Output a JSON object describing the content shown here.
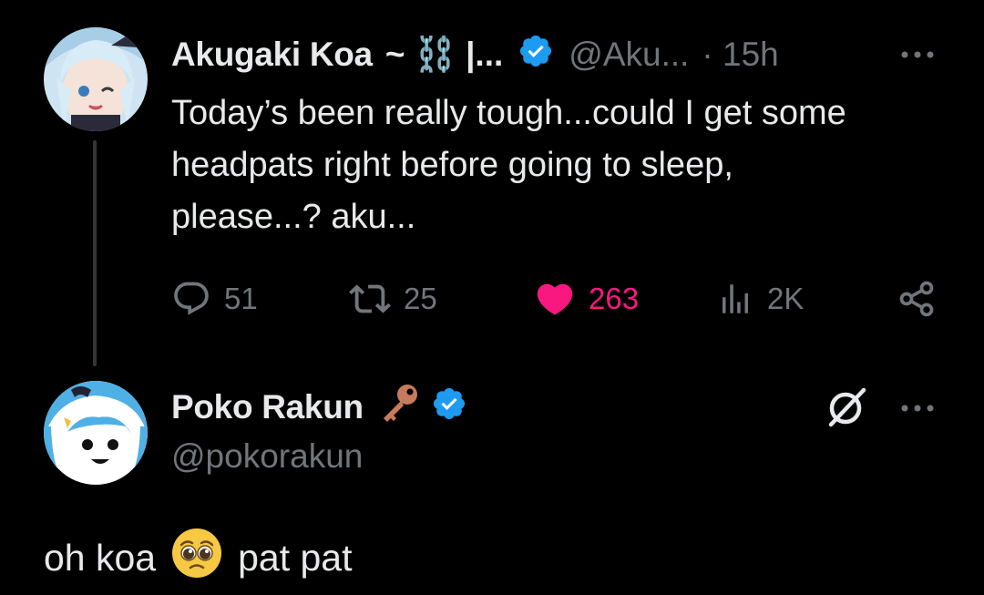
{
  "parent_tweet": {
    "display_name": "Akugaki Koa",
    "name_suffix": "~ ⛓️ |...",
    "handle": "@Aku...",
    "time": "· 15h",
    "text": "Today’s been really tough...could I get some\nheadpats right before going to sleep,\nplease...? aku...",
    "stats": {
      "replies": "51",
      "reposts": "25",
      "likes": "263",
      "views": "2K"
    }
  },
  "reply_tweet": {
    "display_name": "Poko Rakun",
    "handle": "@pokorakun",
    "text_before": "oh koa",
    "text_after": "pat pat"
  },
  "icons": {
    "verified": "verified-badge-icon",
    "more": "more-options-icon",
    "reply": "reply-icon",
    "repost": "repost-icon",
    "like": "heart-icon",
    "views": "views-icon",
    "share": "share-icon",
    "key": "key-icon",
    "grok": "grok-icon",
    "emoji": "pleading-face-emoji"
  },
  "colors": {
    "background": "#000000",
    "text": "#e7e9ea",
    "secondary": "#71767b",
    "like": "#f91880",
    "verified": "#1d9bf0",
    "key": "#c67b5c"
  }
}
